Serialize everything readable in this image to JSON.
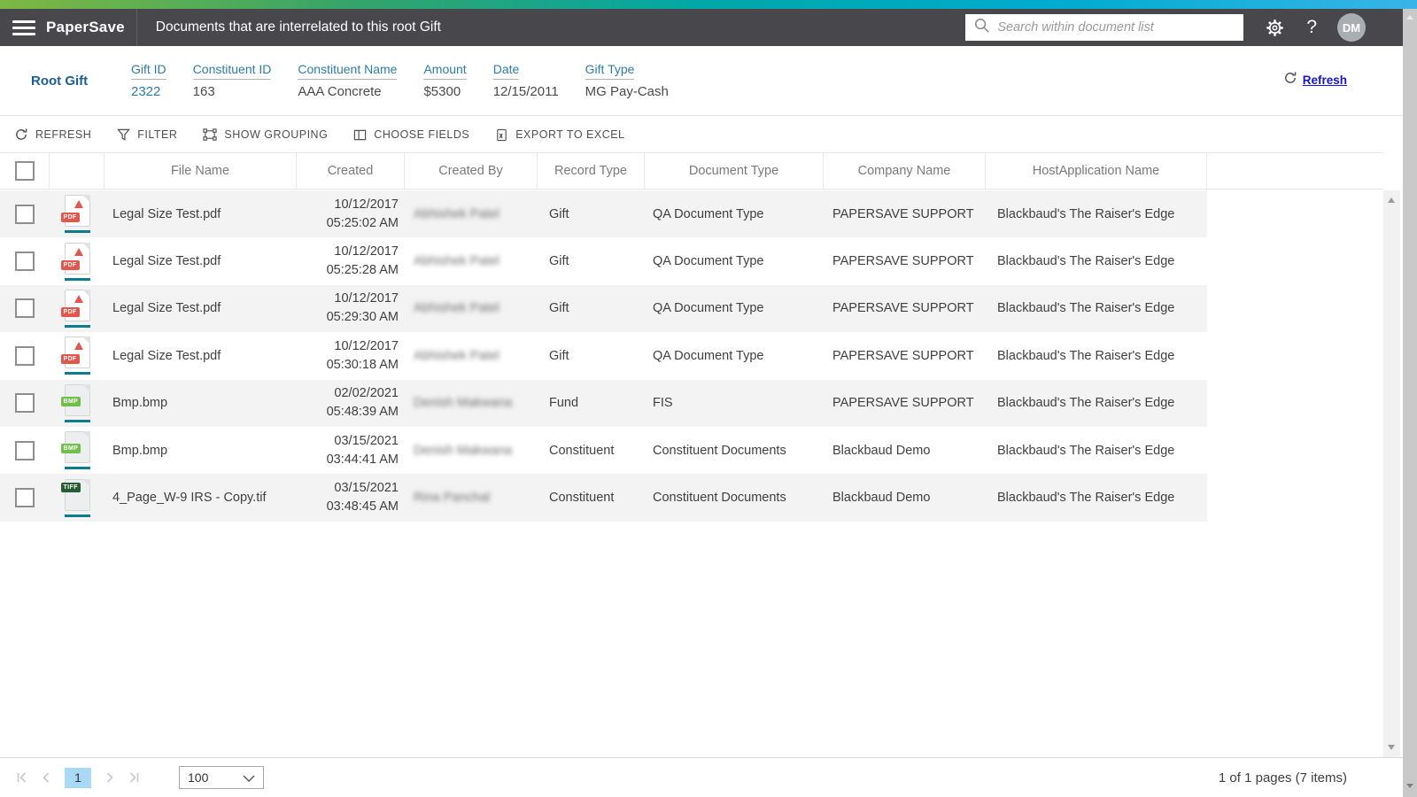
{
  "topbar": {
    "app_name": "PaperSave",
    "page_title": "Documents that are interrelated to this root Gift",
    "search_placeholder": "Search within document list",
    "avatar_initials": "DM"
  },
  "root_gift": {
    "section_label": "Root Gift",
    "refresh_label": "Refresh",
    "fields": [
      {
        "label": "Gift ID",
        "value": "2322",
        "link": true
      },
      {
        "label": "Constituent ID",
        "value": "163",
        "link": false
      },
      {
        "label": "Constituent Name",
        "value": "AAA Concrete",
        "link": false
      },
      {
        "label": "Amount",
        "value": "$5300",
        "link": false
      },
      {
        "label": "Date",
        "value": "12/15/2011",
        "link": false
      },
      {
        "label": "Gift Type",
        "value": "MG Pay-Cash",
        "link": false
      }
    ]
  },
  "toolbar": {
    "buttons": [
      {
        "label": "REFRESH",
        "icon": "refresh-icon"
      },
      {
        "label": "FILTER",
        "icon": "filter-icon"
      },
      {
        "label": "SHOW GROUPING",
        "icon": "show-grouping-icon"
      },
      {
        "label": "CHOOSE FIELDS",
        "icon": "choose-fields-icon"
      },
      {
        "label": "EXPORT TO EXCEL",
        "icon": "export-excel-icon"
      }
    ]
  },
  "table": {
    "columns": [
      "File Name",
      "Created",
      "Created By",
      "Record Type",
      "Document Type",
      "Company Name",
      "HostApplication Name"
    ],
    "rows": [
      {
        "file_type": "pdf",
        "file_badge": "PDF",
        "file_name": "Legal Size Test.pdf",
        "created_date": "10/12/2017",
        "created_time": "05:25:02 AM",
        "created_by": "Abhishek Patel",
        "record_type": "Gift",
        "document_type": "QA Document Type",
        "company_name": "PAPERSAVE SUPPORT",
        "host_application": "Blackbaud's The Raiser's Edge"
      },
      {
        "file_type": "pdf",
        "file_badge": "PDF",
        "file_name": "Legal Size Test.pdf",
        "created_date": "10/12/2017",
        "created_time": "05:25:28 AM",
        "created_by": "Abhishek Patel",
        "record_type": "Gift",
        "document_type": "QA Document Type",
        "company_name": "PAPERSAVE SUPPORT",
        "host_application": "Blackbaud's The Raiser's Edge"
      },
      {
        "file_type": "pdf",
        "file_badge": "PDF",
        "file_name": "Legal Size Test.pdf",
        "created_date": "10/12/2017",
        "created_time": "05:29:30 AM",
        "created_by": "Abhishek Patel",
        "record_type": "Gift",
        "document_type": "QA Document Type",
        "company_name": "PAPERSAVE SUPPORT",
        "host_application": "Blackbaud's The Raiser's Edge"
      },
      {
        "file_type": "pdf",
        "file_badge": "PDF",
        "file_name": "Legal Size Test.pdf",
        "created_date": "10/12/2017",
        "created_time": "05:30:18 AM",
        "created_by": "Abhishek Patel",
        "record_type": "Gift",
        "document_type": "QA Document Type",
        "company_name": "PAPERSAVE SUPPORT",
        "host_application": "Blackbaud's The Raiser's Edge"
      },
      {
        "file_type": "bmp",
        "file_badge": "BMP",
        "file_name": "Bmp.bmp",
        "created_date": "02/02/2021",
        "created_time": "05:48:39 AM",
        "created_by": "Denish Makwana",
        "record_type": "Fund",
        "document_type": "FIS",
        "company_name": "PAPERSAVE SUPPORT",
        "host_application": "Blackbaud's The Raiser's Edge"
      },
      {
        "file_type": "bmp",
        "file_badge": "BMP",
        "file_name": "Bmp.bmp",
        "created_date": "03/15/2021",
        "created_time": "03:44:41 AM",
        "created_by": "Denish Makwana",
        "record_type": "Constituent",
        "document_type": "Constituent Documents",
        "company_name": "Blackbaud Demo",
        "host_application": "Blackbaud's The Raiser's Edge"
      },
      {
        "file_type": "tiff",
        "file_badge": "TIFF",
        "file_name": "4_Page_W-9 IRS - Copy.tif",
        "created_date": "03/15/2021",
        "created_time": "03:48:45 AM",
        "created_by": "Rina Panchal",
        "record_type": "Constituent",
        "document_type": "Constituent Documents",
        "company_name": "Blackbaud Demo",
        "host_application": "Blackbaud's The Raiser's Edge"
      }
    ]
  },
  "footer": {
    "current_page": "1",
    "page_size": "100",
    "summary": "1 of 1 pages (7 items)"
  }
}
